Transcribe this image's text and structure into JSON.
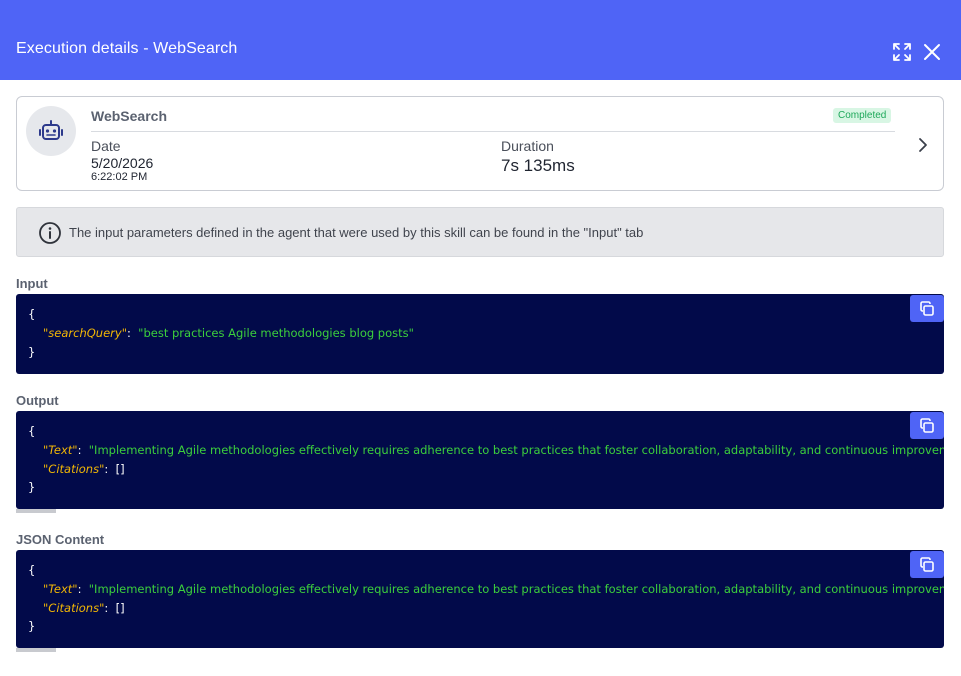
{
  "header": {
    "title": "Execution details - WebSearch",
    "background_color": "#4f64f6",
    "icons": [
      "expand-icon",
      "close-icon"
    ]
  },
  "summary": {
    "skill_name": "WebSearch",
    "status": "Completed",
    "status_color": "#1ea85a",
    "date_label": "Date",
    "date": "5/20/2026",
    "time": "6:22:02 PM",
    "duration_label": "Duration",
    "duration": "7s 135ms",
    "avatar_icon": "robot-icon",
    "nav_icon": "chevron-right-icon"
  },
  "info": {
    "icon": "info-icon",
    "text": "The input parameters defined in the agent that were used by this skill can be found in the \"Input\" tab"
  },
  "input": {
    "label": "Input",
    "open_brace": "{",
    "close_brace": "}",
    "key": "\"searchQuery\"",
    "colon": ":",
    "value": "\"best practices Agile methodologies blog posts\""
  },
  "output": {
    "label": "Output",
    "open_brace": "{",
    "close_brace": "}",
    "text_key": "\"Text\"",
    "text_value": "\"Implementing Agile methodologies effectively requires adherence to best practices that foster collaboration, adaptability, and continuous improvemen",
    "citations_key": "\"Citations\"",
    "citations_value": "[]",
    "colon": ":"
  },
  "json_content": {
    "label": "JSON Content",
    "open_brace": "{",
    "close_brace": "}",
    "text_key": "\"Text\"",
    "text_value": "\"Implementing Agile methodologies effectively requires adherence to best practices that foster collaboration, adaptability, and continuous improvemen",
    "citations_key": "\"Citations\"",
    "citations_value": "[]",
    "colon": ":"
  },
  "colors": {
    "code_background": "#020a4a",
    "json_key": "#f2b705",
    "json_string": "#3ccf3c",
    "copy_button": "#4f64f6"
  }
}
